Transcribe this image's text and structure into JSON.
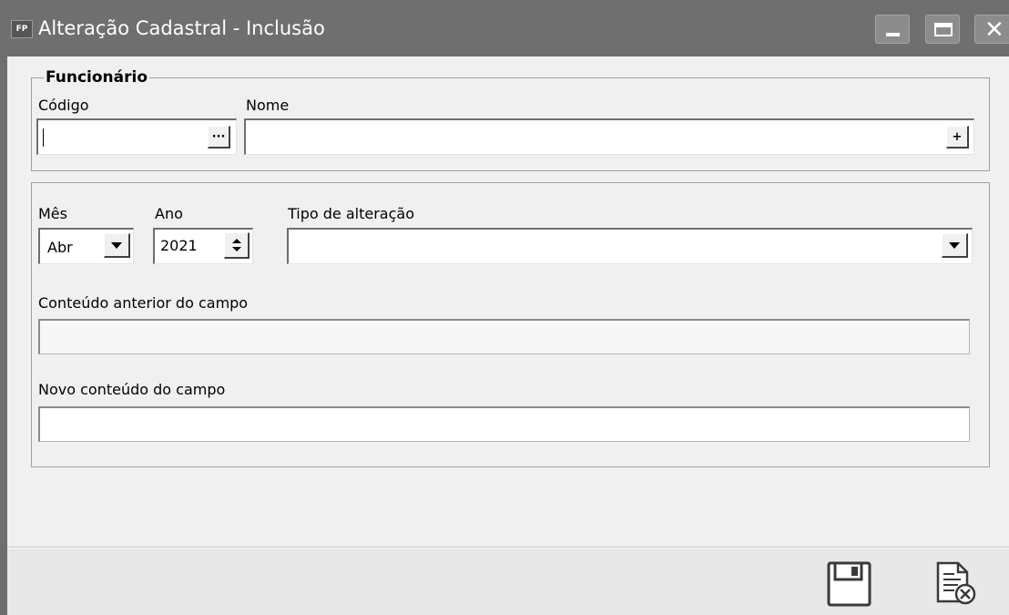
{
  "window": {
    "title": "Alteração Cadastral - Inclusão",
    "app_icon_text": "FP",
    "title_bar_color": "#6f6f6f",
    "controls": {
      "minimize": "minimize-icon",
      "maximize": "maximize-icon",
      "close": "close-icon"
    }
  },
  "funcionario": {
    "legend": "Funcionário",
    "codigo_label": "Código",
    "codigo_value": "",
    "codigo_lookup_label": "···",
    "nome_label": "Nome",
    "nome_value": "",
    "nome_add_label": "+"
  },
  "alteracao": {
    "mes_label": "Mês",
    "mes_value": "Abr",
    "ano_label": "Ano",
    "ano_value": "2021",
    "tipo_label": "Tipo de alteração",
    "tipo_value": "",
    "conteudo_anterior_label": "Conteúdo anterior do campo",
    "conteudo_anterior_value": "",
    "novo_conteudo_label": "Novo conteúdo do campo",
    "novo_conteudo_value": ""
  },
  "toolbar": {
    "save_icon": "floppy-disk-icon",
    "cancel_icon": "cancel-document-icon"
  }
}
